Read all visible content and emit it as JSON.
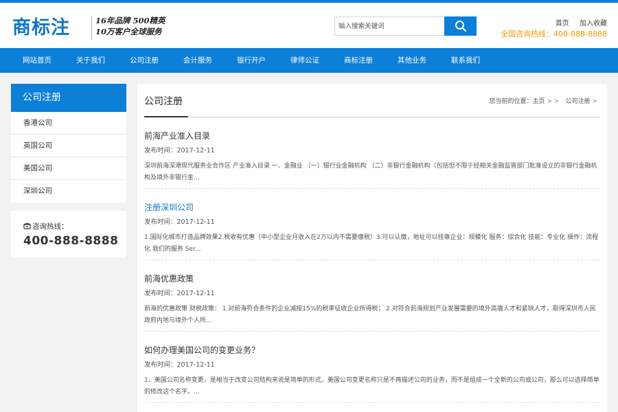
{
  "logo": {
    "text": "商标注"
  },
  "slogan": {
    "line1": "16年品牌 500精英",
    "line2": "10万客户全球服务"
  },
  "search": {
    "placeholder": "输入搜索关键词"
  },
  "toplinks": {
    "home": "首页",
    "favorite": "加入收藏"
  },
  "hotline_top": "全国咨询热线：400-888-8888",
  "nav": [
    {
      "label": "网站首页"
    },
    {
      "label": "关于我们"
    },
    {
      "label": "公司注册"
    },
    {
      "label": "会计服务"
    },
    {
      "label": "银行开户"
    },
    {
      "label": "律师公证"
    },
    {
      "label": "商标注册"
    },
    {
      "label": "其他业务"
    },
    {
      "label": "联系我们"
    }
  ],
  "sidebar": {
    "title": "公司注册",
    "items": [
      {
        "label": "香港公司"
      },
      {
        "label": "英国公司"
      },
      {
        "label": "美国公司"
      },
      {
        "label": "深圳公司"
      }
    ]
  },
  "contact": {
    "label": "咨询热线：",
    "phone": "400-888-8888"
  },
  "main": {
    "title": "公司注册",
    "breadcrumb": {
      "prefix": "您当前的位置：",
      "home": "主页",
      "current": "公司注册"
    }
  },
  "articles": [
    {
      "title": "前海产业准入目录",
      "date": "发布时间：2017-12-11",
      "summary": "深圳前海深港现代服务业合作区 产业准入目录 一、金融业 （一）银行业金融机构 （二）非银行金融机构（包括但不限于经相关金融监管部门批准设立的非银行金融机构及境外非银行金..."
    },
    {
      "title": "注册深圳公司",
      "date": "发布时间：2017-12-11",
      "summary": "1.国际化城市打造品牌效果2.税收有优惠（中小型企业月收入在2万以内不需要缴税）3.可以认缴，地址可以挂靠企业：规模化 服务：综合化 技能：专业化 操作：流程化 我们的服务 Ser..."
    },
    {
      "title": "前海优惠政策",
      "date": "发布时间：2017-12-11",
      "summary": "前海的优惠政策 财税政策： 1.对前海符合条件的企业减按15%的税率征收企业所得税； 2.对符合前海规划产业发展需要的境外高端人才和紧缺人才，取得深圳市人民政府内地与境外个人所..."
    },
    {
      "title": "如何办理美国公司的变更业务？",
      "date": "发布时间：2017-12-11",
      "summary": "1、美国公司名称变更，是相当于改变公司结构来说是简单的形式，美国公司变更名称只是不再描述公司的业务，而不是组成一个全新的公司或公司，那么可以选择简单的修改这个名字。..."
    }
  ],
  "colors": {
    "primary": "#0c7fd8",
    "accent": "#f39800",
    "link": "#1276c9"
  }
}
